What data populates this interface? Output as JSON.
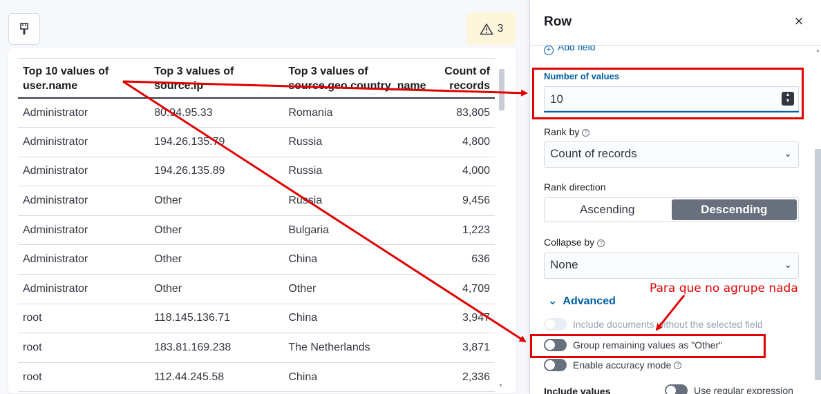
{
  "toolbar": {
    "warning_count": "3"
  },
  "table": {
    "headers": [
      "Top 10 values of user.name",
      "Top 3 values of source.ip",
      "Top 3 values of source.geo.country_name",
      "Count of records"
    ],
    "rows": [
      [
        "Administrator",
        "80.94.95.33",
        "Romania",
        "83,805"
      ],
      [
        "Administrator",
        "194.26.135.79",
        "Russia",
        "4,800"
      ],
      [
        "Administrator",
        "194.26.135.89",
        "Russia",
        "4,000"
      ],
      [
        "Administrator",
        "Other",
        "Russia",
        "9,456"
      ],
      [
        "Administrator",
        "Other",
        "Bulgaria",
        "1,223"
      ],
      [
        "Administrator",
        "Other",
        "China",
        "636"
      ],
      [
        "Administrator",
        "Other",
        "Other",
        "4,709"
      ],
      [
        "root",
        "118.145.136.71",
        "China",
        "3,947"
      ],
      [
        "root",
        "183.81.169.238",
        "The Netherlands",
        "3,871"
      ],
      [
        "root",
        "112.44.245.58",
        "China",
        "2,336"
      ]
    ]
  },
  "panel": {
    "title": "Row",
    "add_field": "Add field",
    "number_of_values_label": "Number of values",
    "number_of_values": "10",
    "rank_by_label": "Rank by",
    "rank_by_value": "Count of records",
    "rank_direction_label": "Rank direction",
    "ascending": "Ascending",
    "descending": "Descending",
    "collapse_by_label": "Collapse by",
    "collapse_by_value": "None",
    "advanced": "Advanced",
    "include_documents": "Include documents without the selected field",
    "group_remaining": "Group remaining values as \"Other\"",
    "enable_accuracy": "Enable accuracy mode",
    "include_values": "Include values",
    "use_regex": "Use regular expression"
  },
  "annotation": {
    "note": "Para que no agrupe nada"
  }
}
